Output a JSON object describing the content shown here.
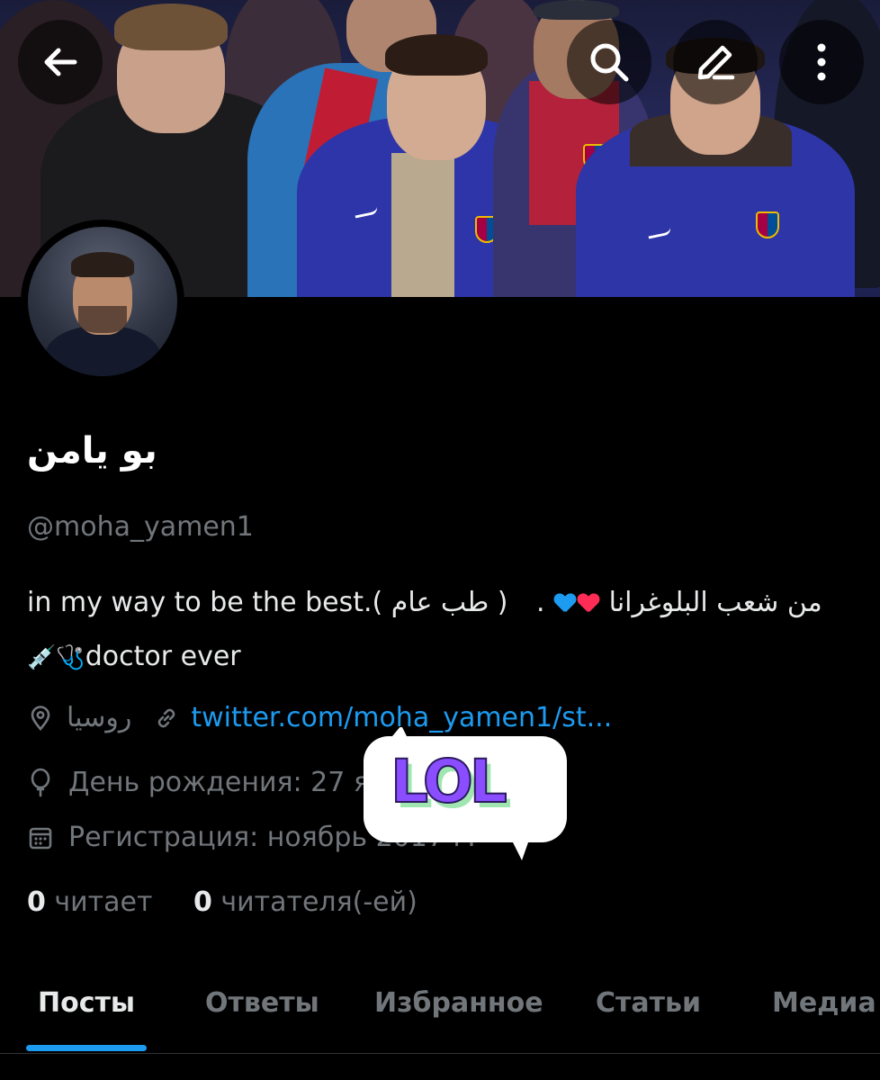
{
  "profile": {
    "display_name": "بو يامن",
    "handle": "@moha_yamen1",
    "bio_line1_prefix": "in my way to be the best.(",
    "bio_line1_paren": " طب عام ",
    "bio_line1_close": ")",
    "bio_line1_dot": ".",
    "bio_line1_arabic": "من شعب البلوغرانا",
    "bio_line2_emoji": "💉🩺",
    "bio_line2_text": "doctor ever",
    "location": "روسيا",
    "website": "twitter.com/moha_yamen1/st...",
    "birthday": "День рождения: 27 я",
    "joined": "Регистрация: ноябрь 2017 г."
  },
  "stats": {
    "following_count": "0",
    "following_label": "читает",
    "followers_count": "0",
    "followers_label": "читателя(-ей)"
  },
  "tabs": [
    {
      "label": "Посты",
      "active": true
    },
    {
      "label": "Ответы",
      "active": false
    },
    {
      "label": "Избранное",
      "active": false
    },
    {
      "label": "Статьи",
      "active": false
    },
    {
      "label": "Медиа",
      "active": false
    }
  ],
  "sticker": {
    "text": "LOL"
  },
  "icons": {
    "back": "back-arrow-icon",
    "search": "search-icon",
    "edit": "edit-icon",
    "more": "more-vertical-icon",
    "location": "location-pin-icon",
    "link": "link-icon",
    "birthday": "balloon-icon",
    "calendar": "calendar-icon"
  },
  "colors": {
    "background": "#000000",
    "text_primary": "#e7e9ea",
    "text_secondary": "#71767b",
    "accent": "#1d9bf0",
    "sticker_purple": "#8a4dff",
    "sticker_green": "#9fe6b0"
  }
}
